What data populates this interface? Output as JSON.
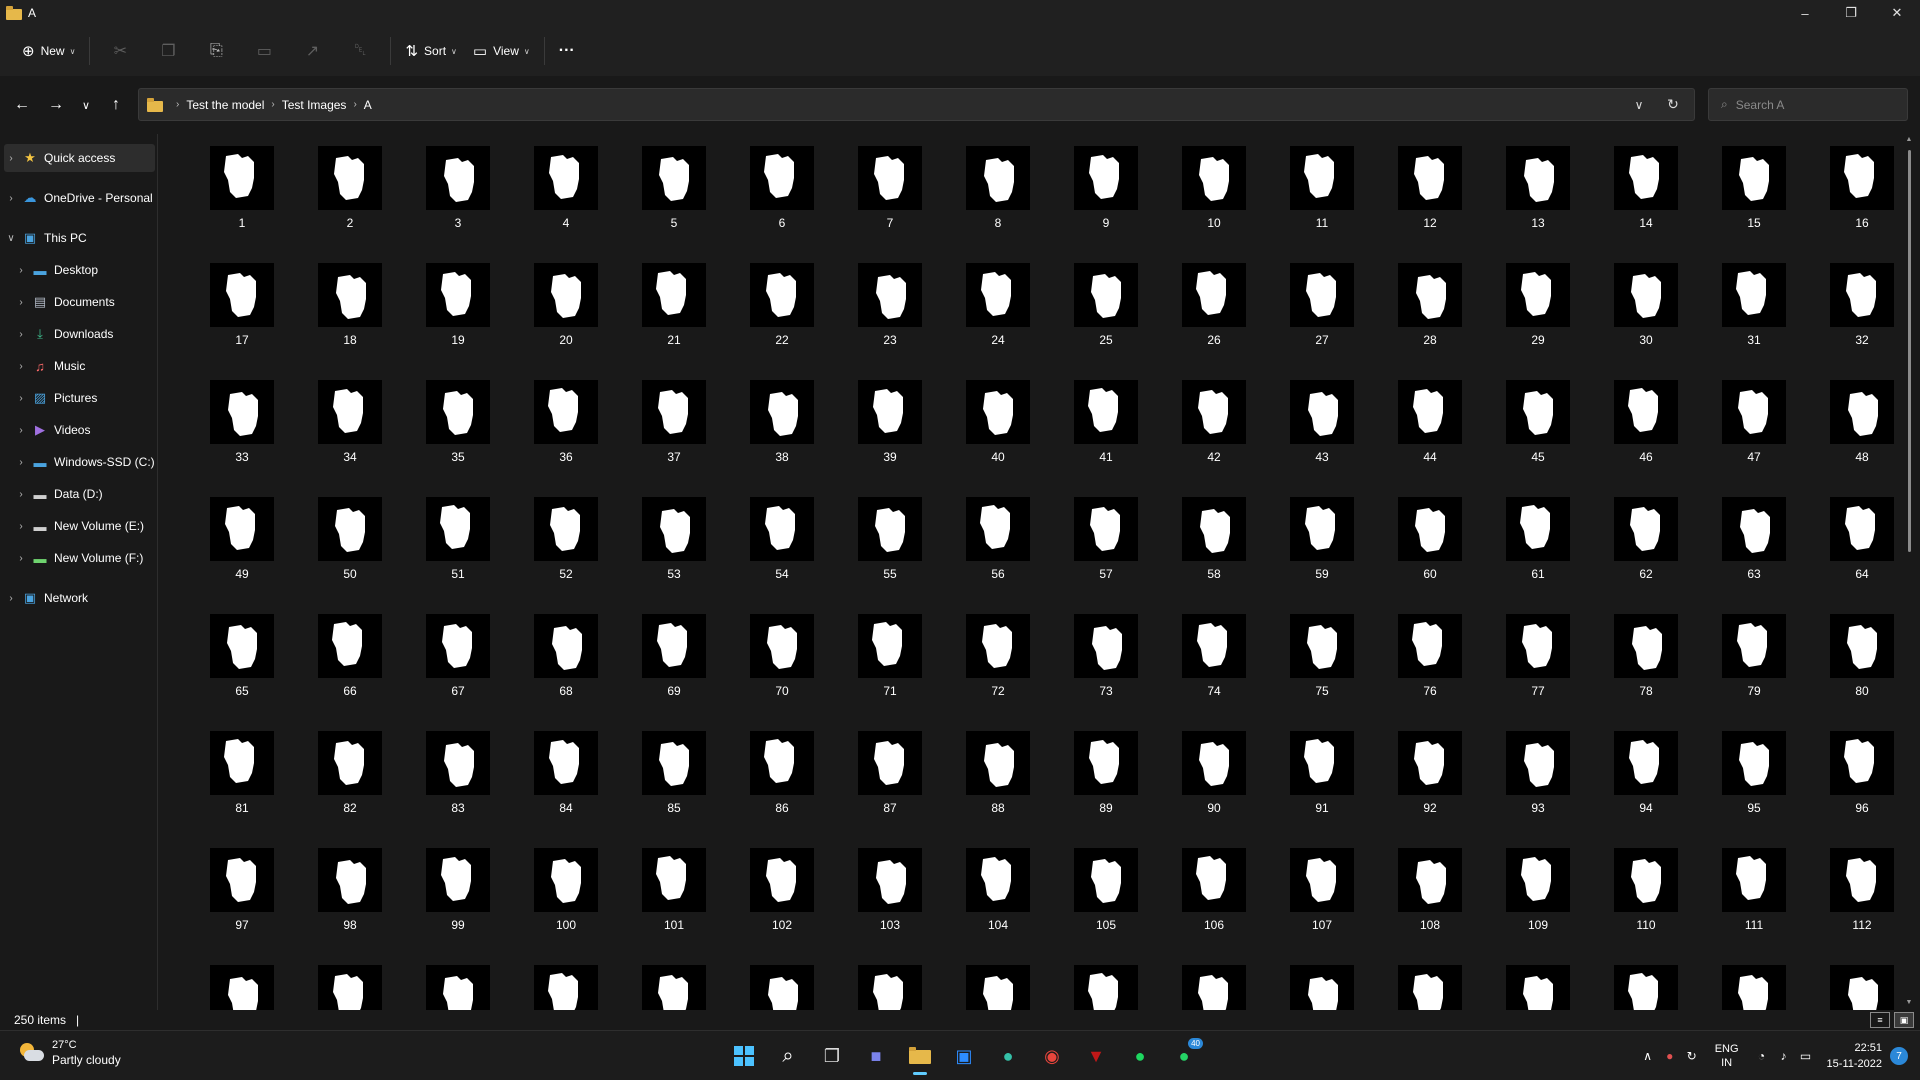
{
  "window": {
    "title": "A"
  },
  "toolbar": {
    "new_label": "New",
    "sort_label": "Sort",
    "view_label": "View",
    "more_label": "···"
  },
  "address": {
    "crumbs": [
      "Test the model",
      "Test Images",
      "A"
    ]
  },
  "search": {
    "placeholder": "Search A"
  },
  "sidebar": {
    "items": [
      {
        "label": "Quick access",
        "icon": "star-icon"
      },
      {
        "label": "OneDrive - Personal",
        "icon": "cloud-icon"
      },
      {
        "label": "This PC",
        "icon": "pc-icon"
      },
      {
        "label": "Desktop",
        "icon": "desktop-icon"
      },
      {
        "label": "Documents",
        "icon": "documents-icon"
      },
      {
        "label": "Downloads",
        "icon": "downloads-icon"
      },
      {
        "label": "Music",
        "icon": "music-icon"
      },
      {
        "label": "Pictures",
        "icon": "pictures-icon"
      },
      {
        "label": "Videos",
        "icon": "videos-icon"
      },
      {
        "label": "Windows-SSD (C:)",
        "icon": "drive-c-icon"
      },
      {
        "label": "Data (D:)",
        "icon": "drive-icon"
      },
      {
        "label": "New Volume (E:)",
        "icon": "drive-icon"
      },
      {
        "label": "New Volume (F:)",
        "icon": "drive-icon"
      },
      {
        "label": "Network",
        "icon": "network-icon"
      }
    ]
  },
  "files": {
    "visible_names": [
      "1",
      "2",
      "3",
      "4",
      "5",
      "6",
      "7",
      "8",
      "9",
      "10",
      "11",
      "12",
      "13",
      "14",
      "15",
      "16",
      "17",
      "18",
      "19",
      "20",
      "21",
      "22",
      "23",
      "24",
      "25",
      "26",
      "27",
      "28",
      "29",
      "30",
      "31",
      "32",
      "33",
      "34",
      "35",
      "36",
      "37",
      "38",
      "39",
      "40",
      "41",
      "42",
      "43",
      "44",
      "45",
      "46",
      "47",
      "48",
      "49",
      "50",
      "51",
      "52",
      "53",
      "54",
      "55",
      "56",
      "57",
      "58",
      "59",
      "60",
      "61",
      "62",
      "63",
      "64",
      "65",
      "66",
      "67",
      "68",
      "69",
      "70",
      "71",
      "72",
      "73",
      "74",
      "75",
      "76",
      "77",
      "78",
      "79",
      "80",
      "81",
      "82",
      "83",
      "84",
      "85",
      "86",
      "87",
      "88",
      "89",
      "90",
      "91",
      "92",
      "93",
      "94",
      "95",
      "96",
      "97",
      "98",
      "99",
      "100",
      "101",
      "102",
      "103",
      "104",
      "105",
      "106",
      "107",
      "108",
      "109",
      "110",
      "111",
      "112"
    ],
    "partial_row_count": 16
  },
  "status": {
    "item_count": "250 items"
  },
  "taskbar": {
    "weather_temp": "27°C",
    "weather_desc": "Partly cloudy",
    "lang_top": "ENG",
    "lang_bottom": "IN",
    "time": "22:51",
    "date": "15-11-2022",
    "notification_count": "7",
    "whatsapp_badge": "40"
  }
}
